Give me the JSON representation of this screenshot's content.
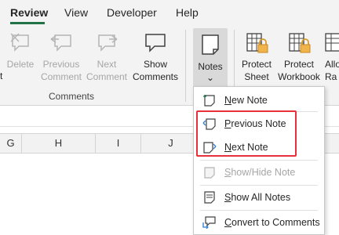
{
  "tabs": [
    {
      "label": "Review",
      "active": true
    },
    {
      "label": "View",
      "active": false
    },
    {
      "label": "Developer",
      "active": false
    },
    {
      "label": "Help",
      "active": false
    }
  ],
  "ribbon": {
    "left_cut_label": "t",
    "buttons": {
      "delete": "Delete",
      "previous_comment": "Previous\nComment",
      "next_comment": "Next\nComment",
      "show_comments": "Show\nComments",
      "notes": "Notes",
      "notes_caret": "⌄",
      "protect_sheet": "Protect\nSheet",
      "protect_workbook": "Protect\nWorkbook",
      "allow_ranges": "Allo\nRa"
    },
    "group_comments_label": "Comments"
  },
  "columns": [
    "G",
    "H",
    "I",
    "J"
  ],
  "notes_menu": {
    "items": [
      {
        "label": "New Note",
        "underline": "N",
        "rest": "ew Note",
        "disabled": false
      },
      {
        "label": "Previous Note",
        "underline": "P",
        "rest": "revious Note",
        "disabled": false
      },
      {
        "label": "Next Note",
        "underline": "N",
        "rest": "ext Note",
        "disabled": false
      },
      {
        "label": "Show/Hide Note",
        "underline": "S",
        "rest": "how/Hide Note",
        "disabled": true
      },
      {
        "label": "Show All Notes",
        "underline": "S",
        "rest": "how All Notes",
        "disabled": false
      },
      {
        "label": "Convert to Comments",
        "underline": "C",
        "rest": "onvert to Comments",
        "disabled": false
      }
    ]
  },
  "colors": {
    "accent": "#217346",
    "highlight": "#e8303a"
  }
}
